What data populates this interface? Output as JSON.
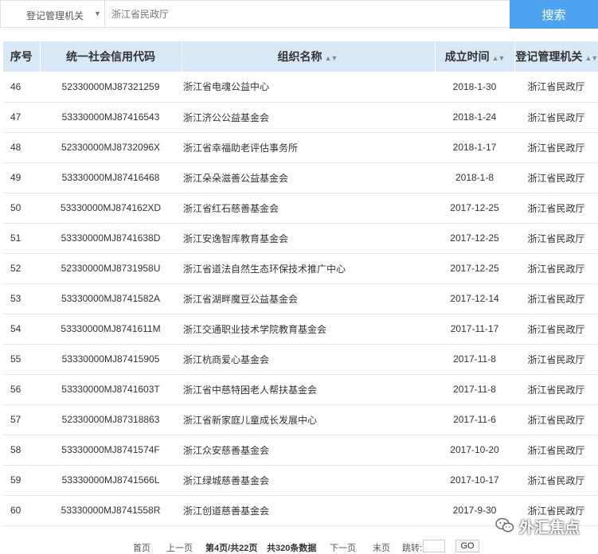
{
  "search": {
    "scope": "登记管理机关",
    "query": "浙江省民政厅",
    "button": "搜索"
  },
  "table": {
    "headers": {
      "index": "序号",
      "code": "统一社会信用代码",
      "name": "组织名称",
      "date": "成立时间",
      "authority": "登记管理机关"
    },
    "rows": [
      {
        "index": "46",
        "code": "52330000MJ87321259",
        "name": "浙江省电魂公益中心",
        "date": "2018-1-30",
        "authority": "浙江省民政厅"
      },
      {
        "index": "47",
        "code": "53330000MJ87416543",
        "name": "浙江济公公益基金会",
        "date": "2018-1-24",
        "authority": "浙江省民政厅"
      },
      {
        "index": "48",
        "code": "52330000MJ8732096X",
        "name": "浙江省幸福助老评估事务所",
        "date": "2018-1-17",
        "authority": "浙江省民政厅"
      },
      {
        "index": "49",
        "code": "53330000MJ87416468",
        "name": "浙江朵朵滋善公益基金会",
        "date": "2018-1-8",
        "authority": "浙江省民政厅"
      },
      {
        "index": "50",
        "code": "53330000MJ874162XD",
        "name": "浙江省红石慈善基金会",
        "date": "2017-12-25",
        "authority": "浙江省民政厅"
      },
      {
        "index": "51",
        "code": "53330000MJ8741638D",
        "name": "浙江安逸智库教育基金会",
        "date": "2017-12-25",
        "authority": "浙江省民政厅"
      },
      {
        "index": "52",
        "code": "52330000MJ8731958U",
        "name": "浙江省道法自然生态环保技术推广中心",
        "date": "2017-12-25",
        "authority": "浙江省民政厅"
      },
      {
        "index": "53",
        "code": "53330000MJ8741582A",
        "name": "浙江省湖畔魔豆公益基金会",
        "date": "2017-12-14",
        "authority": "浙江省民政厅"
      },
      {
        "index": "54",
        "code": "53330000MJ8741611M",
        "name": "浙江交通职业技术学院教育基金会",
        "date": "2017-11-17",
        "authority": "浙江省民政厅"
      },
      {
        "index": "55",
        "code": "53330000MJ87415905",
        "name": "浙江杭商爱心基金会",
        "date": "2017-11-8",
        "authority": "浙江省民政厅"
      },
      {
        "index": "56",
        "code": "53330000MJ8741603T",
        "name": "浙江省中慈特困老人帮扶基金会",
        "date": "2017-11-8",
        "authority": "浙江省民政厅"
      },
      {
        "index": "57",
        "code": "52330000MJ87318863",
        "name": "浙江省新家庭儿童成长发展中心",
        "date": "2017-11-6",
        "authority": "浙江省民政厅"
      },
      {
        "index": "58",
        "code": "53330000MJ8741574F",
        "name": "浙江众安慈善基金会",
        "date": "2017-10-20",
        "authority": "浙江省民政厅"
      },
      {
        "index": "59",
        "code": "53330000MJ8741566L",
        "name": "浙江绿城慈善基金会",
        "date": "2017-10-17",
        "authority": "浙江省民政厅"
      },
      {
        "index": "60",
        "code": "53330000MJ8741558R",
        "name": "浙江创道慈善基金会",
        "date": "2017-9-30",
        "authority": "浙江省民政厅"
      }
    ]
  },
  "pagination": {
    "first": "首页",
    "prev": "上一页",
    "current": "第4页/共22页",
    "total": "共320条数据",
    "next": "下一页",
    "last": "末页",
    "jump_label": "跳转:",
    "go": "GO"
  },
  "watermark": {
    "text": "外汇焦点"
  }
}
